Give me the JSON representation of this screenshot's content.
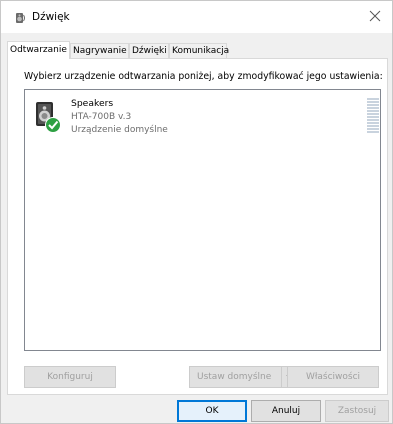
{
  "window": {
    "title": "Dźwięk",
    "close_icon": "close-icon"
  },
  "tabs": [
    {
      "label": "Odtwarzanie",
      "active": true
    },
    {
      "label": "Nagrywanie",
      "active": false
    },
    {
      "label": "Dźwięki",
      "active": false
    },
    {
      "label": "Komunikacja",
      "active": false
    }
  ],
  "panel": {
    "instruction": "Wybierz urządzenie odtwarzania poniżej, aby zmodyfikować jego ustawienia:"
  },
  "devices": [
    {
      "name": "Speakers",
      "model": "HTA-700B v.3",
      "status": "Urządzenie domyślne",
      "icon": "speaker-icon",
      "badge": "default-check-icon",
      "badge_color": "#2ea043",
      "level": 0
    }
  ],
  "panel_buttons": {
    "configure": "Konfiguruj",
    "set_default": "Ustaw domyślne",
    "properties": "Właściwości"
  },
  "dialog_buttons": {
    "ok": "OK",
    "cancel": "Anuluj",
    "apply": "Zastosuj"
  },
  "colors": {
    "accent": "#0078d7",
    "disabled_text": "#a0a0a0"
  }
}
